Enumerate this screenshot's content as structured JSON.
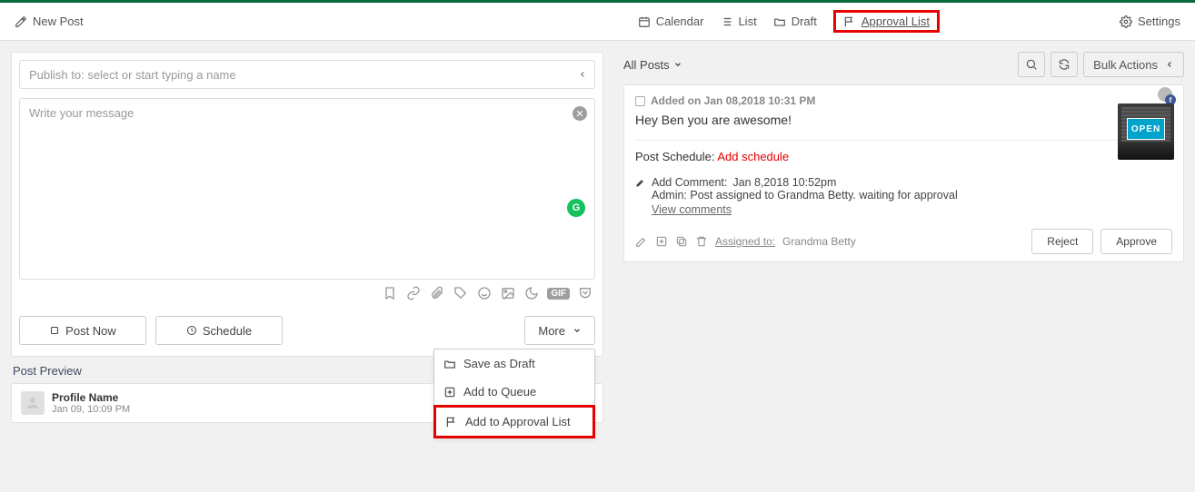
{
  "nav": {
    "new_post": "New Post",
    "calendar": "Calendar",
    "list": "List",
    "draft": "Draft",
    "approval": "Approval List",
    "settings": "Settings"
  },
  "compose": {
    "publish_placeholder": "Publish to: select or start typing a name",
    "message_placeholder": "Write your message",
    "post_now": "Post Now",
    "schedule": "Schedule",
    "more": "More",
    "menu": {
      "save_draft": "Save as Draft",
      "add_queue": "Add to Queue",
      "add_approval": "Add to Approval List"
    }
  },
  "preview": {
    "title": "Post Preview",
    "profile_name": "Profile Name",
    "date": "Jan 09, 10:09 PM"
  },
  "posts": {
    "filter": "All Posts",
    "bulk": "Bulk Actions"
  },
  "post": {
    "added": "Added on Jan 08,2018 10:31 PM",
    "body": "Hey Ben you are awesome!",
    "thumb_text": "OPEN",
    "schedule_label": "Post Schedule:",
    "add_schedule": "Add schedule",
    "comment_label": "Add Comment:",
    "comment_time": "Jan 8,2018 10:52pm",
    "admin_line": "Admin: Post assigned to Grandma Betty. waiting for approval",
    "view_comments": "View comments",
    "assigned_label": "Assigned to:",
    "assigned_to": "Grandma Betty",
    "reject": "Reject",
    "approve": "Approve"
  }
}
